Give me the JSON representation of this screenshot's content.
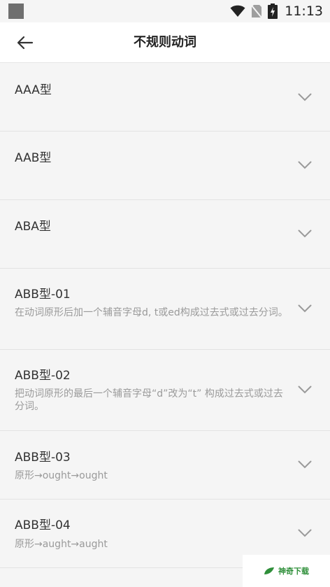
{
  "status_bar": {
    "time": "11:13"
  },
  "app_bar": {
    "title": "不规则动词"
  },
  "items": [
    {
      "title": "AAA型",
      "desc": ""
    },
    {
      "title": "AAB型",
      "desc": ""
    },
    {
      "title": "ABA型",
      "desc": ""
    },
    {
      "title": "ABB型-01",
      "desc": "在动词原形后加一个辅音字母d, t或ed构成过去式或过去分词。"
    },
    {
      "title": "ABB型-02",
      "desc": "把动词原形的最后一个辅音字母“d”改为“t” 构成过去式或过去分词。"
    },
    {
      "title": "ABB型-03",
      "desc": "原形→ought→ought"
    },
    {
      "title": "ABB型-04",
      "desc": "原形→aught→aught"
    }
  ],
  "watermark": {
    "text": "神奇下载"
  },
  "colors": {
    "accent_watermark": "#2f8f3a",
    "text_primary": "#333333",
    "text_secondary": "#9a9a9a"
  }
}
